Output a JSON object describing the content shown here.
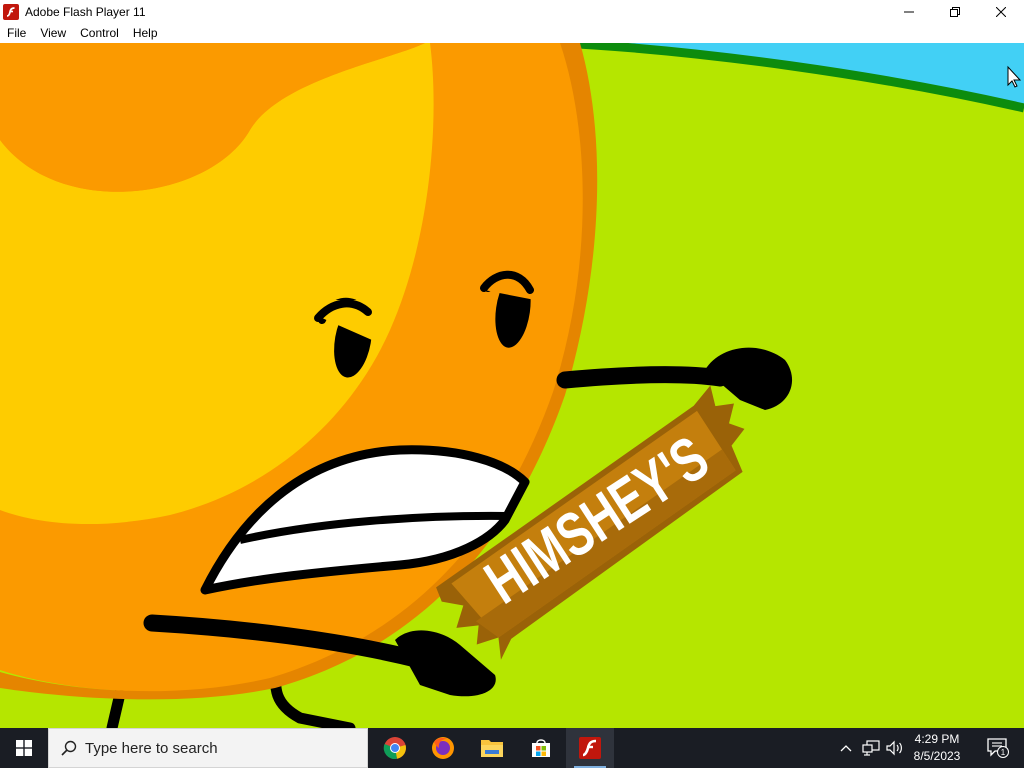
{
  "window": {
    "title": "Adobe Flash Player 11",
    "app_icon": "flash-icon",
    "controls": [
      "minimize-icon",
      "restore-icon",
      "close-icon"
    ]
  },
  "menu": {
    "items": [
      "File",
      "View",
      "Control",
      "Help"
    ]
  },
  "content": {
    "candy_bar_label": "HIMSHEY'S",
    "colors": {
      "sky": "#42d0f5",
      "grass": "#b5e600",
      "hill_edge": "#0d8c0d",
      "body_orange": "#fb9a00",
      "body_dark": "#e58500",
      "body_yellow": "#fecc00",
      "candy_brown": "#c47f0d",
      "candy_dark": "#9a6208"
    }
  },
  "taskbar": {
    "search_placeholder": "Type here to search",
    "apps": [
      "chrome-icon",
      "firefox-icon",
      "file-explorer-icon",
      "store-icon",
      "flash-player-icon"
    ],
    "active_app": "flash-player-icon",
    "tray_icons": [
      "chevron-up-icon",
      "network-icon",
      "volume-icon"
    ],
    "time": "4:29 PM",
    "date": "8/5/2023",
    "notification_count": "1"
  }
}
